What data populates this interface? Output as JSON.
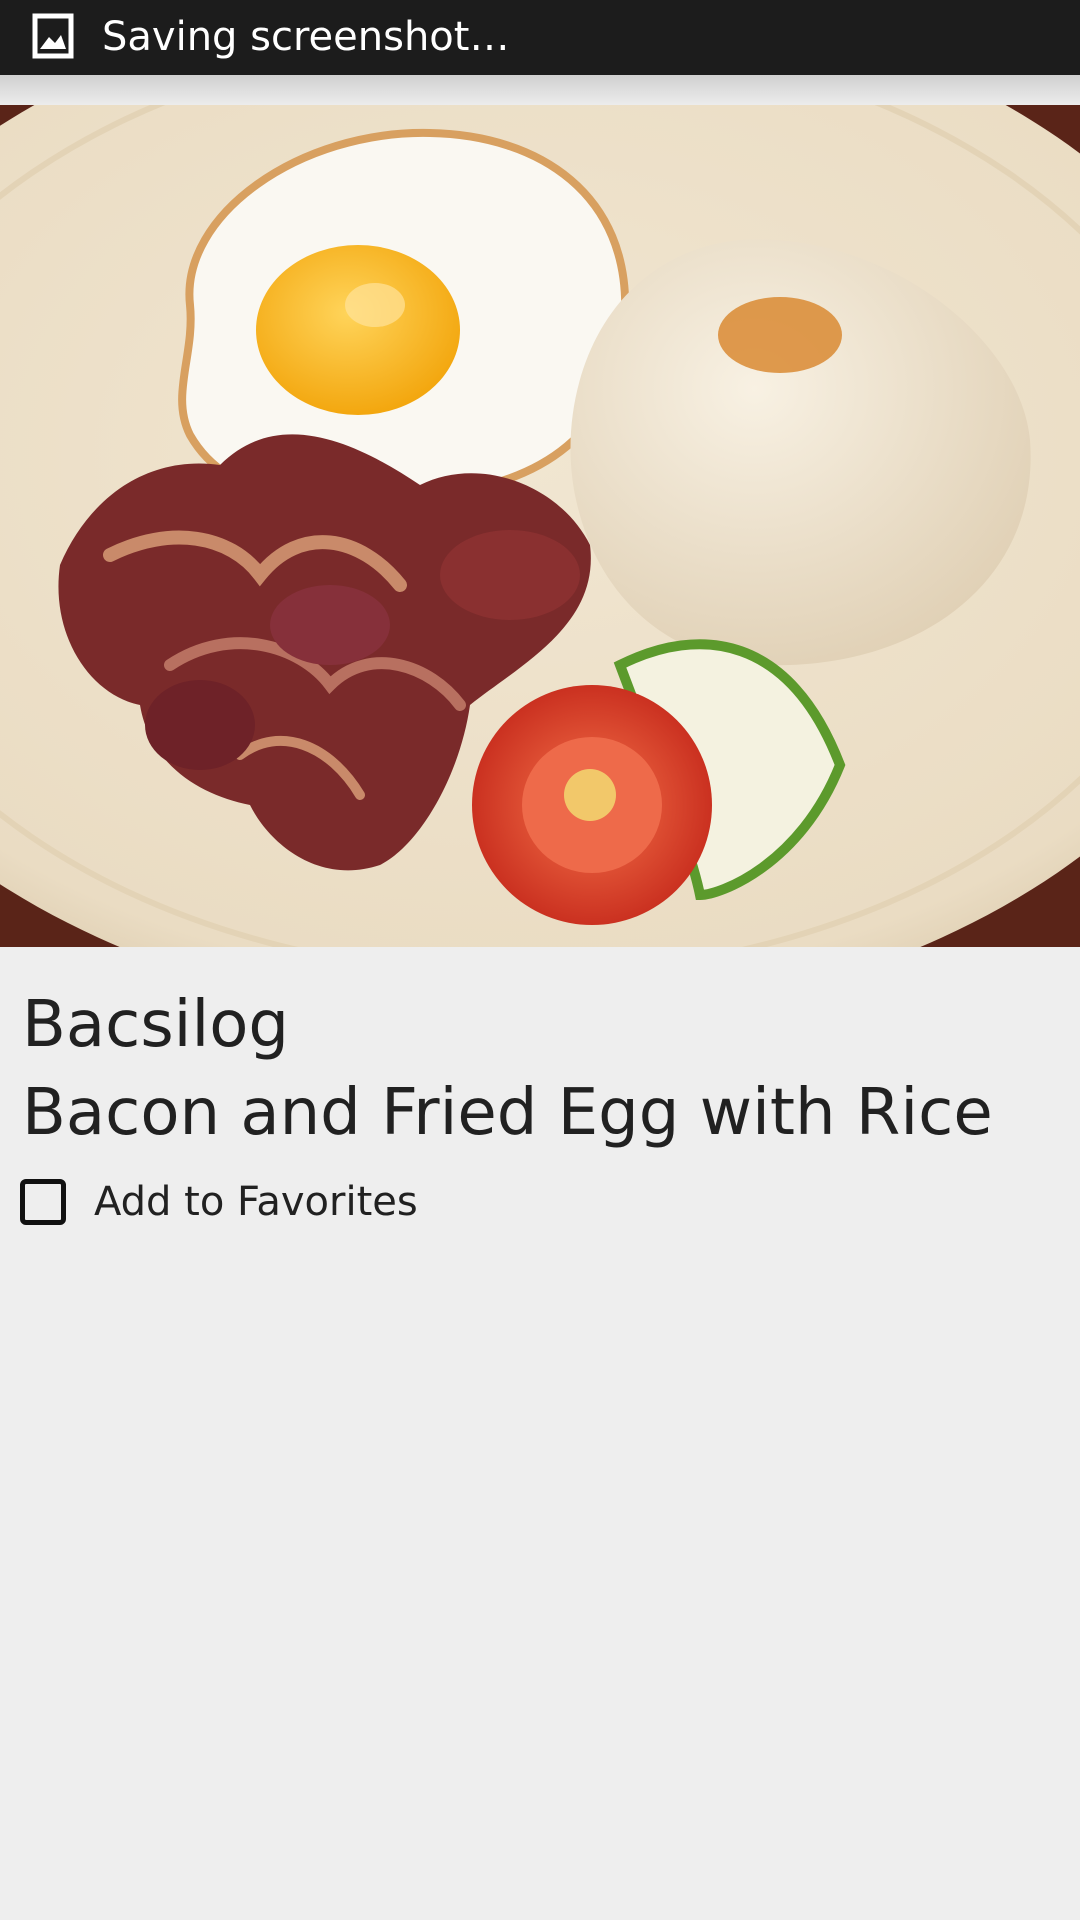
{
  "status_bar": {
    "icon": "image-icon",
    "text": "Saving screenshot…"
  },
  "dish": {
    "image_icon": "food-photo",
    "name": "Bacsilog",
    "description": "Bacon and Fried Egg with Rice"
  },
  "favorite": {
    "label": "Add to Favorites",
    "checked": false
  },
  "colors": {
    "status_bar_bg": "#1c1c1c",
    "page_bg": "#eeeeee",
    "text": "#212121"
  }
}
